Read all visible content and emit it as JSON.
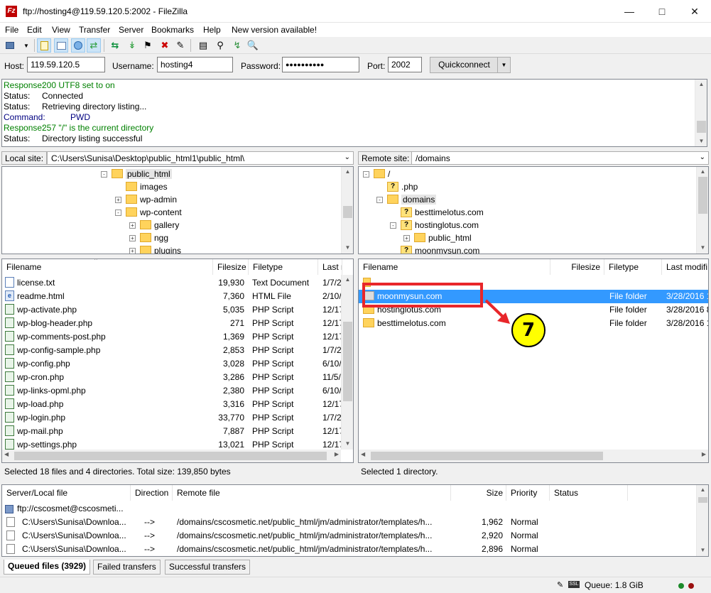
{
  "window": {
    "title": "ftp://hosting4@119.59.120.5:2002 - FileZilla",
    "app_icon": "Fz"
  },
  "menu": [
    "File",
    "Edit",
    "View",
    "Transfer",
    "Server",
    "Bookmarks",
    "Help",
    "New version available!"
  ],
  "quickconnect": {
    "host_label": "Host:",
    "host_value": "119.59.120.5",
    "user_label": "Username:",
    "user_value": "hosting4",
    "pass_label": "Password:",
    "pass_value": "●●●●●●●●●●",
    "port_label": "Port:",
    "port_value": "2002",
    "button_label": "Quickconnect"
  },
  "log": [
    {
      "kind": "Response:",
      "text": "200 UTF8 set to on",
      "cls": "resp"
    },
    {
      "kind": "Status:",
      "text": "Connected",
      "cls": ""
    },
    {
      "kind": "Status:",
      "text": "Retrieving directory listing...",
      "cls": ""
    },
    {
      "kind": "Command:",
      "text": "PWD",
      "cls": "cmd"
    },
    {
      "kind": "Response:",
      "text": "257 \"/\" is the current directory",
      "cls": "resp"
    },
    {
      "kind": "Status:",
      "text": "Directory listing successful",
      "cls": ""
    }
  ],
  "local": {
    "site_label": "Local site:",
    "path": "C:\\Users\\Sunisa\\Desktop\\public_html1\\public_html\\",
    "tree": [
      {
        "name": "public_html",
        "icon": "folder",
        "expander": "-"
      },
      {
        "name": "images",
        "icon": "folder",
        "expander": ""
      },
      {
        "name": "wp-admin",
        "icon": "folder",
        "expander": "+"
      },
      {
        "name": "wp-content",
        "icon": "folder",
        "expander": "-"
      },
      {
        "name": "gallery",
        "icon": "folder",
        "expander": "+"
      },
      {
        "name": "ngg",
        "icon": "folder",
        "expander": "+"
      },
      {
        "name": "plugins",
        "icon": "folder",
        "expander": "+"
      }
    ],
    "headers": [
      "Filename",
      "Filesize",
      "Filetype",
      "Last m"
    ],
    "files": [
      {
        "name": "license.txt",
        "size": "19,930",
        "type": "Text Document",
        "date": "1/7/2",
        "icon": "txt"
      },
      {
        "name": "readme.html",
        "size": "7,360",
        "type": "HTML File",
        "date": "2/10/",
        "icon": "html"
      },
      {
        "name": "wp-activate.php",
        "size": "5,035",
        "type": "PHP Script",
        "date": "12/17",
        "icon": "php"
      },
      {
        "name": "wp-blog-header.php",
        "size": "271",
        "type": "PHP Script",
        "date": "12/17",
        "icon": "php"
      },
      {
        "name": "wp-comments-post.php",
        "size": "1,369",
        "type": "PHP Script",
        "date": "12/17",
        "icon": "php"
      },
      {
        "name": "wp-config-sample.php",
        "size": "2,853",
        "type": "PHP Script",
        "date": "1/7/2",
        "icon": "php"
      },
      {
        "name": "wp-config.php",
        "size": "3,028",
        "type": "PHP Script",
        "date": "6/10/",
        "icon": "php"
      },
      {
        "name": "wp-cron.php",
        "size": "3,286",
        "type": "PHP Script",
        "date": "11/5/",
        "icon": "php"
      },
      {
        "name": "wp-links-opml.php",
        "size": "2,380",
        "type": "PHP Script",
        "date": "6/10/",
        "icon": "php"
      },
      {
        "name": "wp-load.php",
        "size": "3,316",
        "type": "PHP Script",
        "date": "12/17",
        "icon": "php"
      },
      {
        "name": "wp-login.php",
        "size": "33,770",
        "type": "PHP Script",
        "date": "1/7/2",
        "icon": "php"
      },
      {
        "name": "wp-mail.php",
        "size": "7,887",
        "type": "PHP Script",
        "date": "12/17",
        "icon": "php"
      },
      {
        "name": "wp-settings.php",
        "size": "13,021",
        "type": "PHP Script",
        "date": "12/17",
        "icon": "php"
      }
    ],
    "status": "Selected 18 files and 4 directories. Total size: 139,850 bytes"
  },
  "remote": {
    "site_label": "Remote site:",
    "path": "/domains",
    "tree": [
      {
        "name": "/",
        "icon": "folder",
        "expander": "-"
      },
      {
        "name": ".php",
        "icon": "qfolder",
        "expander": ""
      },
      {
        "name": "domains",
        "icon": "folder",
        "expander": "-"
      },
      {
        "name": "besttimelotus.com",
        "icon": "qfolder",
        "expander": ""
      },
      {
        "name": "hostinglotus.com",
        "icon": "qfolder",
        "expander": "-"
      },
      {
        "name": "public_html",
        "icon": "folder",
        "expander": "+"
      },
      {
        "name": "moonmysun.com",
        "icon": "qfolder",
        "expander": ""
      }
    ],
    "headers": [
      "Filename",
      "Filesize",
      "Filetype",
      "Last modifi"
    ],
    "files": [
      {
        "name": "..",
        "size": "",
        "type": "",
        "date": ""
      },
      {
        "name": "moonmysun.com",
        "size": "",
        "type": "File folder",
        "date": "3/28/2016 1"
      },
      {
        "name": "hostinglotus.com",
        "size": "",
        "type": "File folder",
        "date": "3/28/2016 8"
      },
      {
        "name": "besttimelotus.com",
        "size": "",
        "type": "File folder",
        "date": "3/28/2016 1"
      }
    ],
    "status": "Selected 1 directory."
  },
  "annotation": {
    "step": "7",
    "color": "#e8262a",
    "badge_color": "#ffff00"
  },
  "queue": {
    "headers": [
      "Server/Local file",
      "Direction",
      "Remote file",
      "Size",
      "Priority",
      "Status"
    ],
    "server": "ftp://cscosmet@cscosmeti...",
    "rows": [
      {
        "local": "C:\\Users\\Sunisa\\Downloa...",
        "dir": "-->",
        "remote": "/domains/cscosmetic.net/public_html/jm/administrator/templates/h...",
        "size": "1,962",
        "priority": "Normal"
      },
      {
        "local": "C:\\Users\\Sunisa\\Downloa...",
        "dir": "-->",
        "remote": "/domains/cscosmetic.net/public_html/jm/administrator/templates/h...",
        "size": "2,920",
        "priority": "Normal"
      },
      {
        "local": "C:\\Users\\Sunisa\\Downloa...",
        "dir": "-->",
        "remote": "/domains/cscosmetic.net/public_html/jm/administrator/templates/h...",
        "size": "2,896",
        "priority": "Normal"
      }
    ],
    "tabs": [
      "Queued files (3929)",
      "Failed transfers",
      "Successful transfers"
    ],
    "queue_status": "Queue: 1.8 GiB"
  }
}
